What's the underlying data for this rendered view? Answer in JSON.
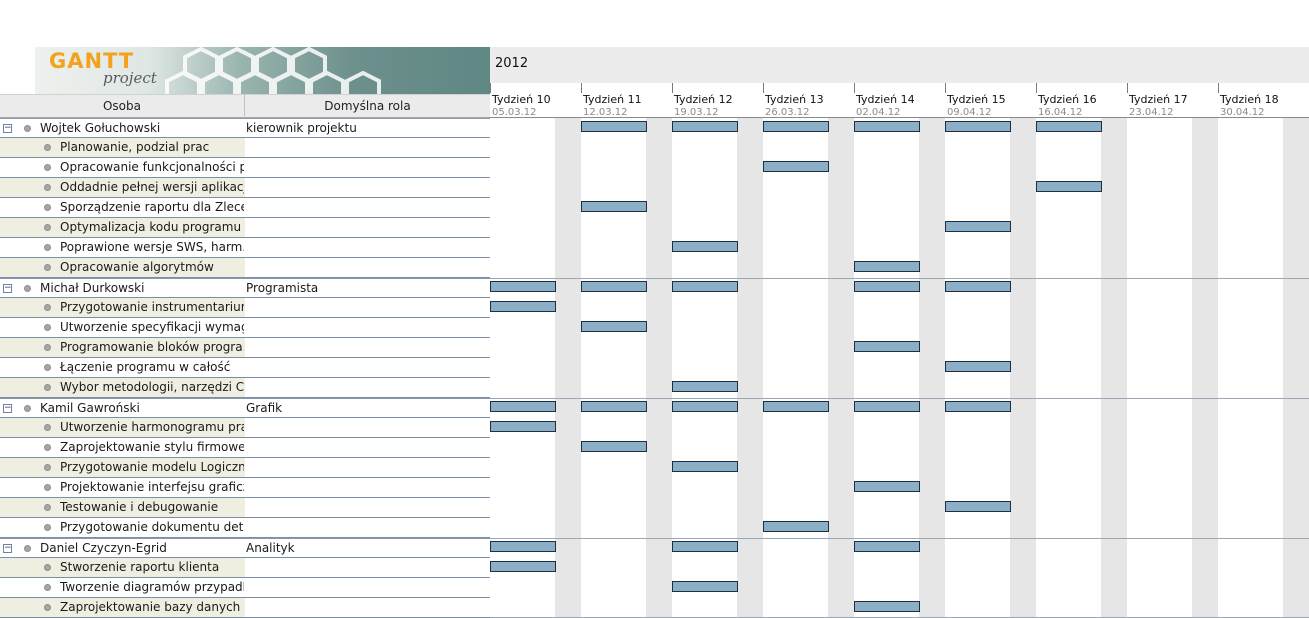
{
  "logo": {
    "text_gantt": "GANTT",
    "text_project": "project"
  },
  "columns": {
    "person": "Osoba",
    "role": "Domyślna rola"
  },
  "year": "2012",
  "weeks": [
    {
      "label": "Tydzień 10",
      "date": "05.03.12"
    },
    {
      "label": "Tydzień 11",
      "date": "12.03.12"
    },
    {
      "label": "Tydzień 12",
      "date": "19.03.12"
    },
    {
      "label": "Tydzień 13",
      "date": "26.03.12"
    },
    {
      "label": "Tydzień 14",
      "date": "02.04.12"
    },
    {
      "label": "Tydzień 15",
      "date": "09.04.12"
    },
    {
      "label": "Tydzień 16",
      "date": "16.04.12"
    },
    {
      "label": "Tydzień 17",
      "date": "23.04.12"
    },
    {
      "label": "Tydzień 18",
      "date": "30.04.12"
    }
  ],
  "rows": [
    {
      "type": "resource",
      "toggle": "−",
      "name": "Wojtek Gołuchowski",
      "role": "kierownik projektu",
      "weeks": [
        1,
        2,
        3,
        4,
        5,
        6
      ]
    },
    {
      "type": "task",
      "name": "Planowanie, podzial prac",
      "weeks": []
    },
    {
      "type": "task",
      "name": "Opracowanie funkcjonalności pr...",
      "weeks": [
        3
      ]
    },
    {
      "type": "task",
      "name": "Oddadnie pełnej wersji aplikacji",
      "weeks": [
        6
      ]
    },
    {
      "type": "task",
      "name": "Sporządzenie raportu dla Zlecen...",
      "weeks": [
        1
      ]
    },
    {
      "type": "task",
      "name": "Optymalizacja kodu programu",
      "weeks": [
        5
      ]
    },
    {
      "type": "task",
      "name": "Poprawione wersje SWS, harm...",
      "weeks": [
        2
      ]
    },
    {
      "type": "task",
      "name": "Opracowanie algorytmów",
      "weeks": [
        4
      ]
    },
    {
      "type": "resource",
      "toggle": "−",
      "name": "Michał Durkowski",
      "role": "Programista",
      "weeks": [
        0,
        1,
        2,
        4,
        5
      ]
    },
    {
      "type": "task",
      "name": "Przygotowanie instrumentarium",
      "weeks": [
        0
      ]
    },
    {
      "type": "task",
      "name": "Utworzenie specyfikacji wymaga...",
      "weeks": [
        1
      ]
    },
    {
      "type": "task",
      "name": "Programowanie bloków progra...",
      "weeks": [
        4
      ]
    },
    {
      "type": "task",
      "name": "Łączenie programu w całość",
      "weeks": [
        5
      ]
    },
    {
      "type": "task",
      "name": "Wybor metodologii, narzędzi CA...",
      "weeks": [
        2
      ]
    },
    {
      "type": "resource",
      "toggle": "−",
      "name": "Kamil Gawroński",
      "role": "Grafik",
      "weeks": [
        0,
        1,
        2,
        3,
        4,
        5
      ]
    },
    {
      "type": "task",
      "name": "Utworzenie harmonogramu pracy",
      "weeks": [
        0
      ]
    },
    {
      "type": "task",
      "name": "Zaprojektowanie stylu firmowego",
      "weeks": [
        1
      ]
    },
    {
      "type": "task",
      "name": "Przygotowanie modelu Logiczne...",
      "weeks": [
        2
      ]
    },
    {
      "type": "task",
      "name": "Projektowanie interfejsu graficz...",
      "weeks": [
        4
      ]
    },
    {
      "type": "task",
      "name": "Testowanie i debugowanie",
      "weeks": [
        5
      ]
    },
    {
      "type": "task",
      "name": "Przygotowanie dokumentu detal...",
      "weeks": [
        3
      ]
    },
    {
      "type": "resource",
      "toggle": "−",
      "name": "Daniel Czyczyn-Egrid",
      "role": "Analityk",
      "weeks": [
        0,
        2,
        4
      ]
    },
    {
      "type": "task",
      "name": "Stworzenie raportu klienta",
      "weeks": [
        0
      ]
    },
    {
      "type": "task",
      "name": "Tworzenie diagramów przypadk...",
      "weeks": [
        2
      ]
    },
    {
      "type": "task",
      "name": "Zaprojektowanie bazy danych",
      "weeks": [
        4
      ]
    }
  ],
  "colors": {
    "bar_fill": "#8aafc6",
    "bar_border": "#1f2f3f",
    "weekend": "#e6e6e6",
    "row_alt": "#efefe1"
  }
}
